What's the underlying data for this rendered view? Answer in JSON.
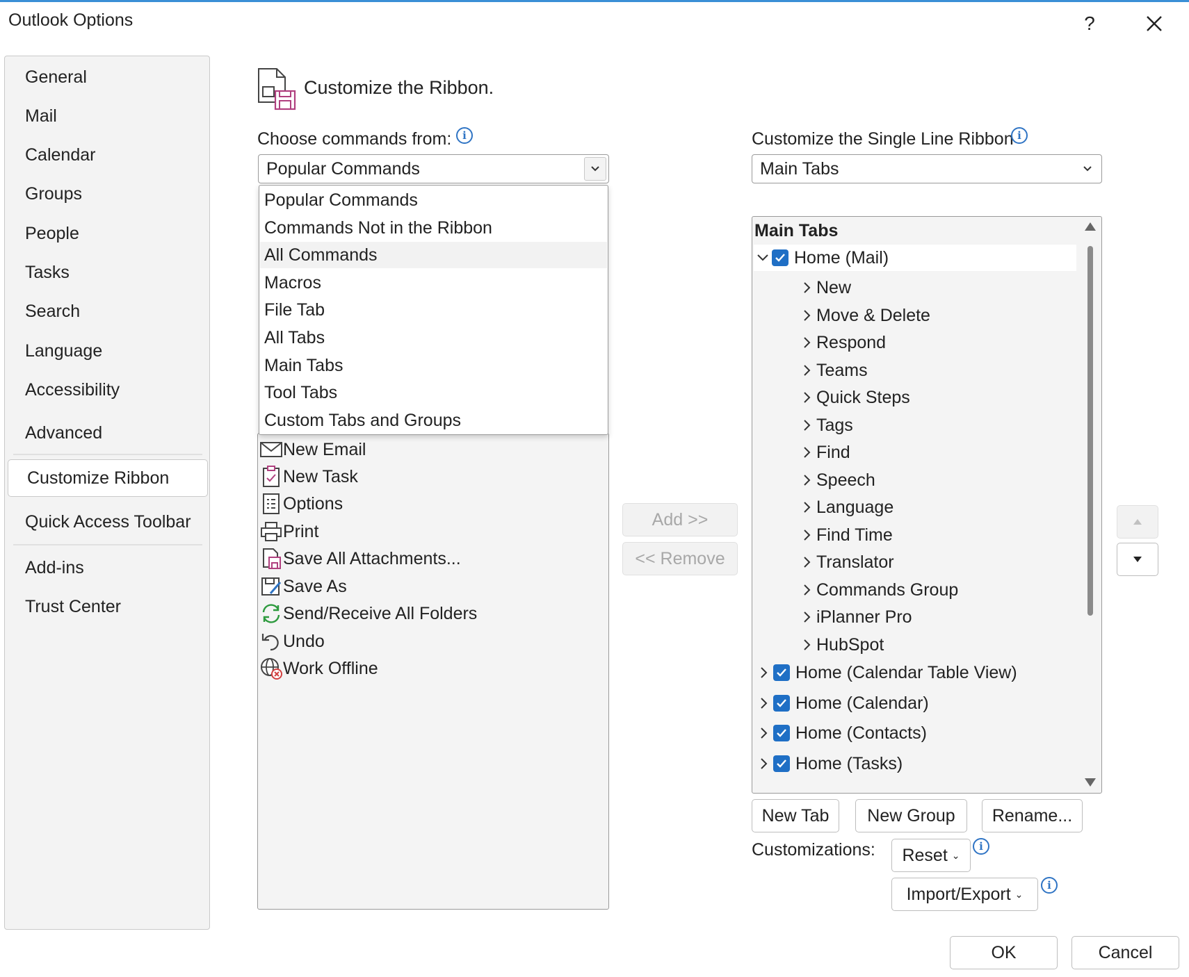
{
  "window": {
    "title": "Outlook Options",
    "help_label": "?",
    "close_label": "✕"
  },
  "sidebar": {
    "items": [
      {
        "label": "General"
      },
      {
        "label": "Mail"
      },
      {
        "label": "Calendar"
      },
      {
        "label": "Groups"
      },
      {
        "label": "People"
      },
      {
        "label": "Tasks"
      },
      {
        "label": "Search"
      },
      {
        "label": "Language"
      },
      {
        "label": "Accessibility"
      },
      {
        "label": "Advanced"
      },
      {
        "label": "Customize Ribbon",
        "selected": true
      },
      {
        "label": "Quick Access Toolbar"
      },
      {
        "label": "Add-ins"
      },
      {
        "label": "Trust Center"
      }
    ]
  },
  "main": {
    "title": "Customize the Ribbon.",
    "choose_label": "Choose commands from:",
    "choose_value": "Popular Commands",
    "dropdown_options": [
      "Popular Commands",
      "Commands Not in the Ribbon",
      "All Commands",
      "Macros",
      "File Tab",
      "All Tabs",
      "Main Tabs",
      "Tool Tabs",
      "Custom Tabs and Groups"
    ],
    "hovered_option": "All Commands",
    "commands": [
      {
        "label": "New Email",
        "icon": "envelope-icon"
      },
      {
        "label": "New Task",
        "icon": "clipboard-check-icon"
      },
      {
        "label": "Options",
        "icon": "options-list-icon"
      },
      {
        "label": "Print",
        "icon": "printer-icon"
      },
      {
        "label": "Save All Attachments...",
        "icon": "save-attachments-icon"
      },
      {
        "label": "Save As",
        "icon": "save-as-icon"
      },
      {
        "label": "Send/Receive All Folders",
        "icon": "sync-icon"
      },
      {
        "label": "Undo",
        "icon": "undo-icon"
      },
      {
        "label": "Work Offline",
        "icon": "globe-offline-icon"
      }
    ],
    "add_label": "Add >>",
    "remove_label": "<< Remove"
  },
  "ribbon": {
    "customize_label": "Customize the Single Line Ribbon",
    "customize_value": "Main Tabs",
    "tree_header": "Main Tabs",
    "tree_rows": [
      {
        "label": "Home (Mail)",
        "level": 0,
        "expanded": true,
        "checked": true
      },
      {
        "label": "New",
        "level": 1
      },
      {
        "label": "Move & Delete",
        "level": 1
      },
      {
        "label": "Respond",
        "level": 1
      },
      {
        "label": "Teams",
        "level": 1
      },
      {
        "label": "Quick Steps",
        "level": 1
      },
      {
        "label": "Tags",
        "level": 1
      },
      {
        "label": "Find",
        "level": 1
      },
      {
        "label": "Speech",
        "level": 1
      },
      {
        "label": "Language",
        "level": 1
      },
      {
        "label": "Find Time",
        "level": 1
      },
      {
        "label": "Translator",
        "level": 1
      },
      {
        "label": "Commands Group",
        "level": 1
      },
      {
        "label": "iPlanner Pro",
        "level": 1
      },
      {
        "label": "HubSpot",
        "level": 1
      },
      {
        "label": "Home (Calendar Table View)",
        "level": 0,
        "expanded": false,
        "checked": true
      },
      {
        "label": "Home (Calendar)",
        "level": 0,
        "expanded": false,
        "checked": true
      },
      {
        "label": "Home (Contacts)",
        "level": 0,
        "expanded": false,
        "checked": true
      },
      {
        "label": "Home (Tasks)",
        "level": 0,
        "expanded": false,
        "checked": true
      }
    ],
    "new_tab_label": "New Tab",
    "new_group_label": "New Group",
    "rename_label": "Rename...",
    "customizations_label": "Customizations:",
    "reset_label": "Reset",
    "import_export_label": "Import/Export"
  },
  "footer": {
    "ok_label": "OK",
    "cancel_label": "Cancel"
  },
  "colors": {
    "checkbox": "#1f6fc5",
    "info": "#2f74c4",
    "accent_border": "#3a8fd6"
  }
}
